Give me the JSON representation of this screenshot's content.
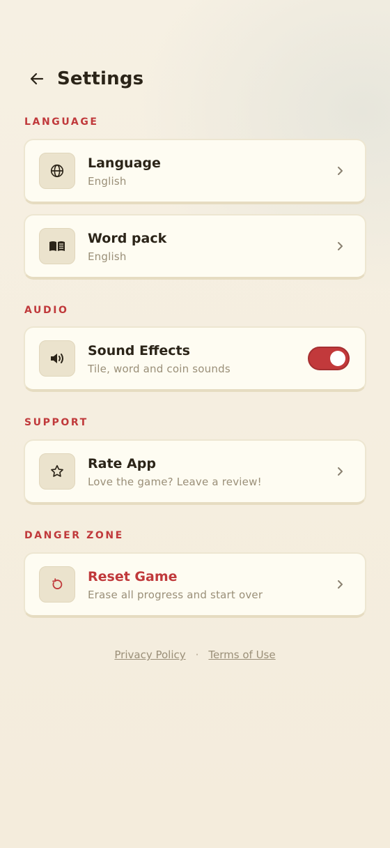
{
  "header": {
    "title": "Settings",
    "back_icon": "arrow-left-icon"
  },
  "sections": {
    "language": {
      "label": "LANGUAGE",
      "items": [
        {
          "title": "Language",
          "subtitle": "English",
          "icon": "globe-icon"
        },
        {
          "title": "Word pack",
          "subtitle": "English",
          "icon": "book-open-icon"
        }
      ]
    },
    "audio": {
      "label": "AUDIO",
      "items": [
        {
          "title": "Sound Effects",
          "subtitle": "Tile, word and coin sounds",
          "icon": "speaker-icon",
          "toggle_on": true
        }
      ]
    },
    "support": {
      "label": "SUPPORT",
      "items": [
        {
          "title": "Rate App",
          "subtitle": "Love the game? Leave a review!",
          "icon": "star-icon"
        }
      ]
    },
    "danger": {
      "label": "DANGER ZONE",
      "items": [
        {
          "title": "Reset Game",
          "subtitle": "Erase all progress and start over",
          "icon": "reset-icon"
        }
      ]
    }
  },
  "footer": {
    "privacy": "Privacy Policy",
    "separator": "·",
    "terms": "Terms of Use"
  },
  "colors": {
    "accent": "#c0393b",
    "background": "#f6f0e3",
    "card": "#fefcf2",
    "icon_box": "#ebe3cd"
  }
}
